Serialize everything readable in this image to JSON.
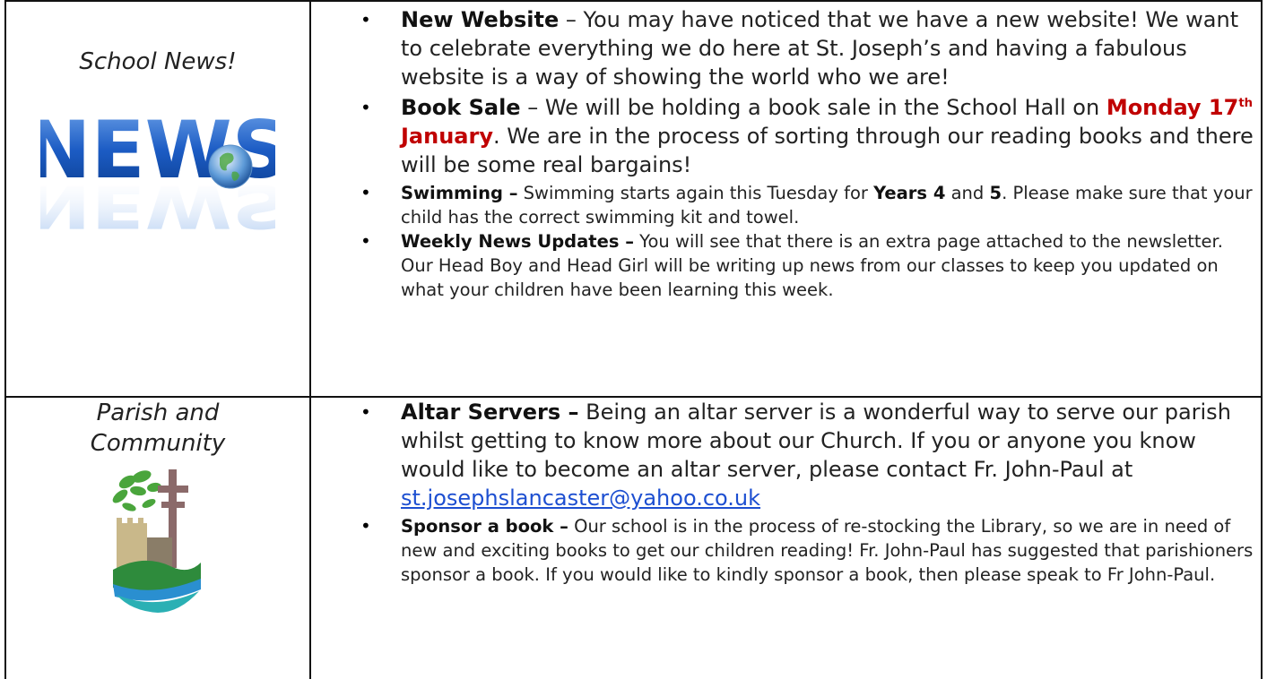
{
  "school_news": {
    "heading": "School News!",
    "logo_text": "NEWS",
    "items": [
      {
        "title": "New Website",
        "sep": " – ",
        "text": "You may have noticed that we have a new website!  We want to celebrate everything we do here at St. Joseph’s and having a fabulous website is a way of showing the world who we are!"
      },
      {
        "title": "Book Sale",
        "sep": " – ",
        "text_before": "We will be holding a book sale in the School Hall on ",
        "date_day": "Monday 17",
        "date_sup": "th",
        "date_month": " January",
        "text_after": ".  We are in the process of sorting through our reading books and there will be some real bargains!"
      },
      {
        "title": "Swimming –",
        "text_before": " Swimming starts again this Tuesday for ",
        "bold1": "Years 4",
        "mid": " and ",
        "bold2": "5",
        "text_after": ".  Please make sure that your child has the correct swimming kit and towel."
      },
      {
        "title": "Weekly News Updates –",
        "text": " You will see that there is an extra page attached to the newsletter.  Our Head Boy and Head Girl will be writing up news from our classes to keep you updated on what your children have been learning this week."
      }
    ]
  },
  "parish": {
    "heading_line1": "Parish and",
    "heading_line2": "Community",
    "items": [
      {
        "title": "Altar Servers –",
        "text": " Being an altar server is a wonderful way to serve our parish whilst getting to know more about our Church. If you or anyone you know would like to become an altar server, please contact Fr. John-Paul at ",
        "email": "st.josephslancaster@yahoo.co.uk"
      },
      {
        "title": "Sponsor a book –",
        "text": " Our school is in the process of re-stocking the Library, so we are in need of new and exciting books to get our children reading!  Fr. John-Paul has suggested that parishioners sponsor a book. If you would like to kindly sponsor a book, then please speak to Fr John-Paul."
      }
    ]
  },
  "colors": {
    "date_red": "#c00000",
    "link_blue": "#1d4fd1",
    "news_blue": "#1c5cc4",
    "leaf_green": "#4aa53c"
  }
}
